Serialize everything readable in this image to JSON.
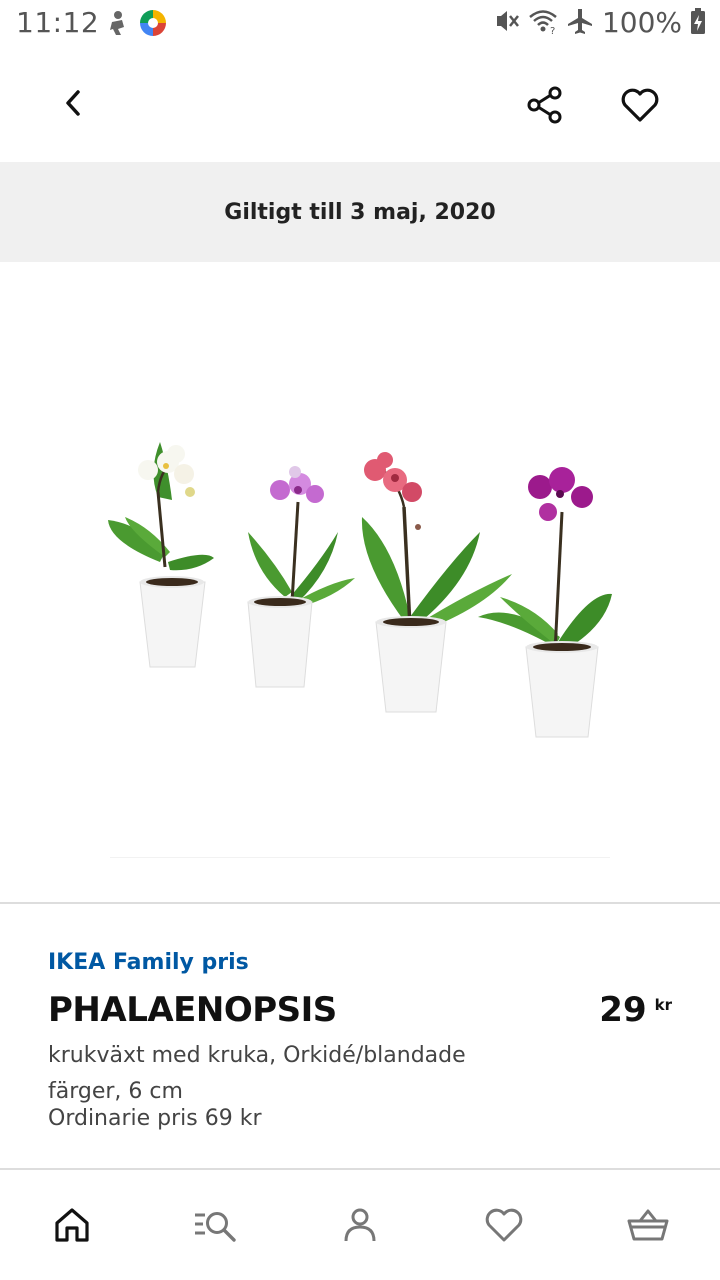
{
  "status_bar": {
    "time": "11:12",
    "battery": "100%",
    "left_icons": [
      "notification-app-icon",
      "photos-app-icon"
    ],
    "right_icons": [
      "vibrate-icon",
      "wifi-icon",
      "airplane-mode-icon",
      "battery-charging-icon"
    ]
  },
  "top_bar": {
    "back_icon": "chevron-left-icon",
    "share_icon": "share-icon",
    "favorite_icon": "heart-outline-icon"
  },
  "banner": {
    "validity": "Giltigt till 3 maj, 2020"
  },
  "product": {
    "family_label": "IKEA Family pris",
    "name": "PHALAENOPSIS",
    "price": "29",
    "currency": "kr",
    "description": "krukväxt med kruka, Orkidé/blandade färger, 6 cm",
    "regular_price": "Ordinarie pris 69 kr",
    "flower_colors": [
      "#f7f7f0",
      "#c46ad0",
      "#e05a72",
      "#9c1a8c"
    ],
    "family_color": "#0058a3"
  },
  "bottom_nav": {
    "items": [
      "home-icon",
      "search-list-icon",
      "profile-icon",
      "heart-outline-icon",
      "basket-icon"
    ],
    "active": "home-icon"
  }
}
